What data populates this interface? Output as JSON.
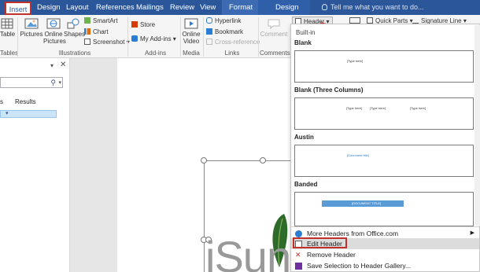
{
  "tabs": [
    "Insert",
    "Design",
    "Layout",
    "References",
    "Mailings",
    "Review",
    "View",
    "Format",
    "Design"
  ],
  "tell_me": "Tell me what you want to do...",
  "ribbon": {
    "table": "Table",
    "tables_group": "Tables",
    "pictures": "Pictures",
    "online_pictures": "Online Pictures",
    "shapes": "Shapes",
    "smartart": "SmartArt",
    "chart": "Chart",
    "screenshot": "Screenshot",
    "illustrations_group": "Illustrations",
    "store": "Store",
    "my_addins": "My Add-ins",
    "addins_group": "Add-ins",
    "online_video": "Online Video",
    "media_group": "Media",
    "hyperlink": "Hyperlink",
    "bookmark": "Bookmark",
    "cross_reference": "Cross-reference",
    "links_group": "Links",
    "comment": "Comment",
    "comments_group": "Comments",
    "header": "Header",
    "quick_parts": "Quick Parts",
    "signature_line": "Signature Line"
  },
  "nav": {
    "results": "Results"
  },
  "doc": {
    "big_text": "iSun"
  },
  "gallery": {
    "builtin_label": "Built-in",
    "sections": [
      {
        "name": "Blank",
        "fields": [
          "[Type here]"
        ]
      },
      {
        "name": "Blank (Three Columns)",
        "fields": [
          "[Type here]",
          "[Type here]",
          "[Type here]"
        ]
      },
      {
        "name": "Austin",
        "fields": [
          "[Document title]"
        ]
      },
      {
        "name": "Banded",
        "fields": [
          "[DOCUMENT TITLE]"
        ]
      }
    ],
    "menu": [
      "More Headers from Office.com",
      "Edit Header",
      "Remove Header",
      "Save Selection to Header Gallery..."
    ]
  },
  "colors": {
    "accent": "#2b579a",
    "highlight_red": "#c0312b"
  }
}
